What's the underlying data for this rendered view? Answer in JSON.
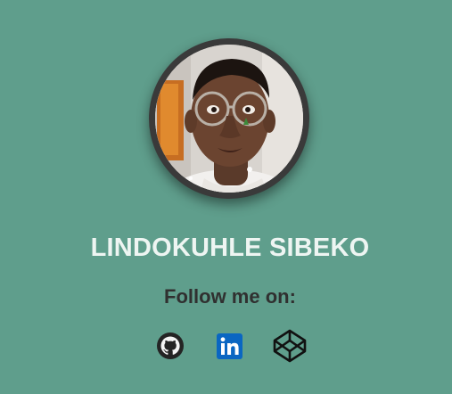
{
  "profile": {
    "name": "LINDOKUHLE SIBEKO",
    "follow_label": "Follow me on:"
  },
  "socials": [
    {
      "icon": "github-icon",
      "color": "#222222"
    },
    {
      "icon": "linkedin-icon",
      "color": "#0a66c2"
    },
    {
      "icon": "codepen-icon",
      "color": "#111111"
    }
  ],
  "colors": {
    "background": "#5f9e8c",
    "name_text": "#eef5f2",
    "follow_text": "#303030",
    "avatar_ring": "#3a3a3a"
  }
}
